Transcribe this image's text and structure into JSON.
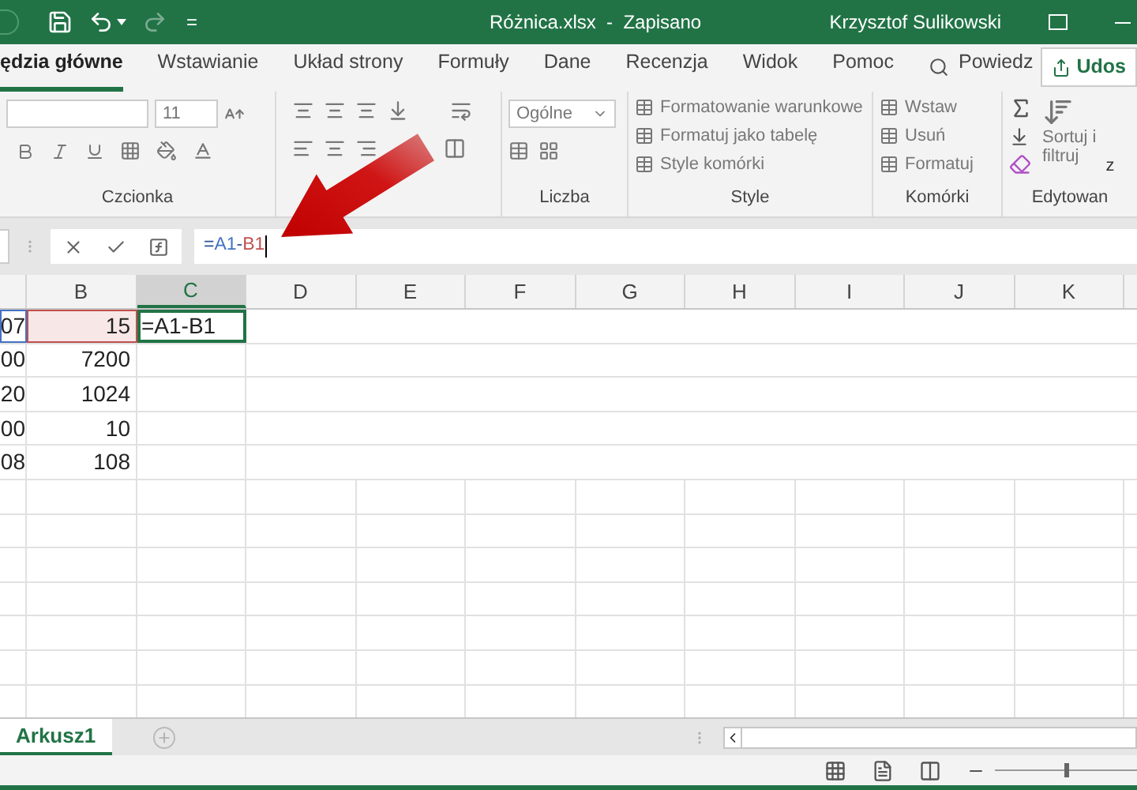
{
  "title_bar": {
    "title": "Różnica.xlsx  -  Zapisano",
    "user": "Krzysztof Sulikowski",
    "customize": "="
  },
  "tabs": [
    {
      "label": "ędzia główne",
      "selected": true
    },
    {
      "label": "Wstawianie",
      "selected": false
    },
    {
      "label": "Układ strony",
      "selected": false
    },
    {
      "label": "Formuły",
      "selected": false
    },
    {
      "label": "Dane",
      "selected": false
    },
    {
      "label": "Recenzja",
      "selected": false
    },
    {
      "label": "Widok",
      "selected": false
    },
    {
      "label": "Pomoc",
      "selected": false
    }
  ],
  "tell_me": "Powiedz",
  "share": "Udos",
  "ribbon": {
    "font_size": "11",
    "font_group": "Czcionka",
    "number_format": "Ogólne",
    "number_group": "Liczba",
    "styles": [
      "Formatowanie warunkowe",
      "Formatuj jako tabelę",
      "Style komórki"
    ],
    "styles_group": "Style",
    "cells": [
      "Wstaw",
      "Usuń",
      "Formatuj"
    ],
    "cells_group": "Komórki",
    "sort": [
      "Sortuj i",
      "filtruj"
    ],
    "editing_cut": "z",
    "editing_group": "Edytowan"
  },
  "formula_bar": {
    "parts": [
      {
        "text": "=",
        "color": "#2f5597"
      },
      {
        "text": "A1",
        "color": "#4472c4"
      },
      {
        "text": "-",
        "color": "#2f5597"
      },
      {
        "text": "B1",
        "color": "#c0504d"
      }
    ]
  },
  "columns": [
    {
      "label": "B",
      "selected": false
    },
    {
      "label": "C",
      "selected": true
    },
    {
      "label": "D",
      "selected": false
    },
    {
      "label": "E",
      "selected": false
    },
    {
      "label": "F",
      "selected": false
    },
    {
      "label": "G",
      "selected": false
    },
    {
      "label": "H",
      "selected": false
    },
    {
      "label": "I",
      "selected": false
    },
    {
      "label": "J",
      "selected": false
    },
    {
      "label": "K",
      "selected": false
    }
  ],
  "rows": [
    {
      "cells": [
        {
          "text": "07",
          "color": "#4472c4",
          "selected": false
        },
        {
          "text": "15",
          "color": "#c0504d",
          "selected": false
        },
        {
          "text": "=A1-B1",
          "selected": true
        }
      ]
    },
    {
      "cells": [
        {
          "text": "00",
          "selected": false
        },
        {
          "text": "7200",
          "selected": false
        },
        {
          "text": "",
          "selected": false
        }
      ]
    },
    {
      "cells": [
        {
          "text": "20",
          "selected": false
        },
        {
          "text": "1024",
          "selected": false
        },
        {
          "text": "",
          "selected": false
        }
      ]
    },
    {
      "cells": [
        {
          "text": "00",
          "selected": false
        },
        {
          "text": "10",
          "selected": false
        },
        {
          "text": "",
          "selected": false
        }
      ]
    },
    {
      "cells": [
        {
          "text": "08",
          "selected": false
        },
        {
          "text": "108",
          "selected": false
        },
        {
          "text": "",
          "selected": false
        }
      ]
    }
  ],
  "sheets": [
    {
      "label": "Arkusz1",
      "selected": true
    }
  ],
  "zoom": {
    "level": 0.5
  }
}
